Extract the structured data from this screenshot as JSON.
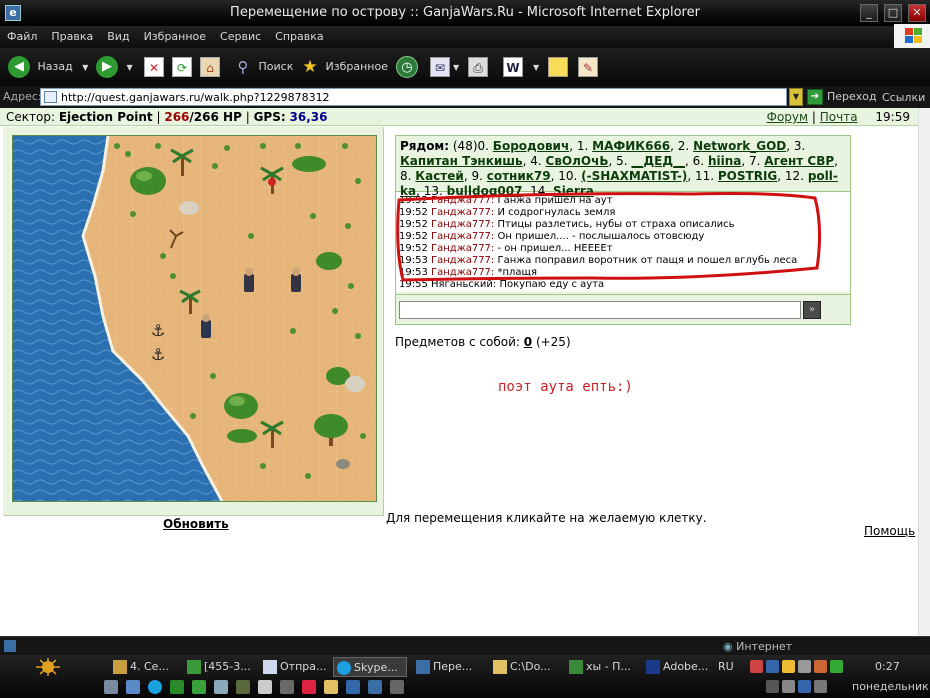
{
  "window": {
    "title": "Перемещение по острову :: GanjaWars.Ru - Microsoft Internet Explorer",
    "min": "_",
    "max": "□",
    "close": "✕"
  },
  "menu": [
    "Файл",
    "Правка",
    "Вид",
    "Избранное",
    "Сервис",
    "Справка"
  ],
  "toolbar": {
    "back": "Назад",
    "search": "Поиск",
    "favorites": "Избранное"
  },
  "address": {
    "label": "Адрес:",
    "url": "http://quest.ganjawars.ru/walk.php?1229878312",
    "go": "Переход",
    "links": "Ссылки"
  },
  "info": {
    "sector_label": "Сектор:",
    "sector": "Ejection Point",
    "sep1": "|",
    "hp_current": "266",
    "hp_max": "/266 HP",
    "sep2": "|",
    "gps_label": "GPS:",
    "gps": "36,36",
    "forum": "Форум",
    "sep3": "|",
    "mail": "Почта",
    "time": "19:59"
  },
  "nearby": {
    "label": "Рядом:",
    "count": "(48)",
    "players": [
      {
        "n": "0.",
        "name": "Бородович"
      },
      {
        "n": "1.",
        "name": "МАФИК666"
      },
      {
        "n": "2.",
        "name": "Network_GOD"
      },
      {
        "n": "3.",
        "name": "Капитан Тэнкишь"
      },
      {
        "n": "4.",
        "name": "СвОлОчЬ"
      },
      {
        "n": "5.",
        "name": "__ДЕД__"
      },
      {
        "n": "6.",
        "name": "hiina"
      },
      {
        "n": "7.",
        "name": "Агент СВР"
      },
      {
        "n": "8.",
        "name": "Кастей"
      },
      {
        "n": "9.",
        "name": "сотник79"
      },
      {
        "n": "10.",
        "name": "(-SHAXMATIST-)"
      },
      {
        "n": "11.",
        "name": "POSTRIG"
      },
      {
        "n": "12.",
        "name": "poll-ka"
      },
      {
        "n": "13.",
        "name": "bulldog007"
      },
      {
        "n": "14.",
        "name": "Sierra"
      }
    ],
    "more": "..."
  },
  "chat": [
    {
      "time": "19:52",
      "who": "Ганджа777:",
      "text": "Ганжа пришел на аут"
    },
    {
      "time": "19:52",
      "who": "Ганджа777:",
      "text": "И содрогнулась земля"
    },
    {
      "time": "19:52",
      "who": "Ганджа777:",
      "text": "Птицы разлетись, нубы от страха описались"
    },
    {
      "time": "19:52",
      "who": "Ганджа777:",
      "text": "Он пришел.... - послышалось отовсюду"
    },
    {
      "time": "19:52",
      "who": "Ганджа777:",
      "text": "- он пришел... НЕЕЕЕт"
    },
    {
      "time": "19:53",
      "who": "Ганджа777:",
      "text": "Ганжа поправил воротник от пащя и пошел вглубь леса"
    },
    {
      "time": "19:53",
      "who": "Ганджа777:",
      "text": "*плащя"
    },
    {
      "time": "19:55",
      "who": "Няганьский:",
      "text": "Покупаю еду с аута"
    }
  ],
  "chat_send": "»",
  "items": {
    "label": "Предметов с собой:",
    "count": "0",
    "extra": "(+25)"
  },
  "handwritten": "поэт аута епть:)",
  "refresh": "Обновить",
  "hint": "Для перемещения кликайте на желаемую клетку.",
  "help": "Помощь",
  "status": {
    "zone": "Интернет"
  },
  "taskbar": {
    "tasks": [
      "4. Се...",
      "[455-3...",
      "Отпра...",
      "Skype...",
      "Пере...",
      "C:\\Do...",
      "хы - П...",
      "Adobe...",
      "RU"
    ],
    "time": "0:27",
    "day": "понедельник"
  },
  "colors": {
    "sand": "#e6b57a",
    "sea": "#2a6fb0",
    "panel": "#e8f4e0",
    "chat_name": "#8b0000",
    "annotation": "#d01010"
  }
}
